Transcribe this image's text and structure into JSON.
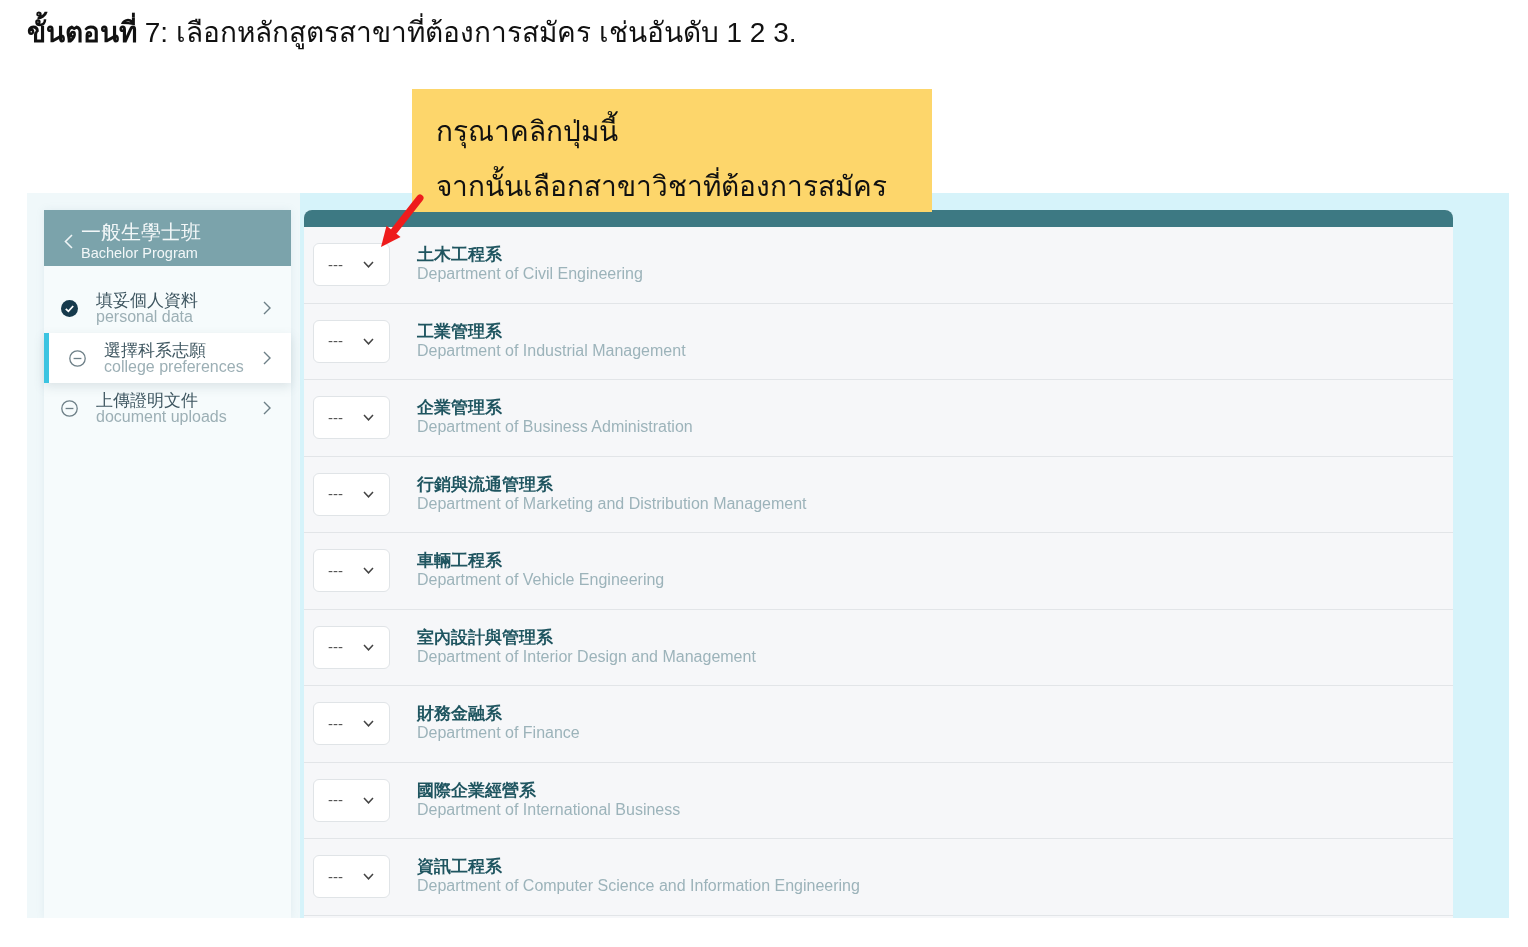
{
  "instruction": {
    "text": "**ขั้นตอนที่** 7: เลือกหลักสูตรสาขาที่ต้องการสมัคร เช่นอันดับ 1 2 3."
  },
  "callout": {
    "lines": [
      "กรุณาคลิกปุ่มนี้",
      "จากนั้นเลือกสาขาวิชาที่ต้องการสมัคร"
    ]
  },
  "sidebar": {
    "title": "一般生學士班",
    "subtitle": "Bachelor Program",
    "items": [
      {
        "label": "填妥個人資料",
        "sublabel": "personal data",
        "completed": true,
        "selected": false
      },
      {
        "label": "選擇科系志願",
        "sublabel": "college preferences",
        "completed": false,
        "selected": true
      },
      {
        "label": "上傳證明文件",
        "sublabel": "document uploads",
        "completed": false,
        "selected": false
      }
    ]
  },
  "departments": [
    {
      "name": "土木工程系",
      "name_en": "Department of Civil Engineering",
      "rank": "---"
    },
    {
      "name": "工業管理系",
      "name_en": "Department of Industrial Management",
      "rank": "---"
    },
    {
      "name": "企業管理系",
      "name_en": "Department of Business Administration",
      "rank": "---"
    },
    {
      "name": "行銷與流通管理系",
      "name_en": "Department of Marketing and Distribution Management",
      "rank": "---"
    },
    {
      "name": "車輛工程系",
      "name_en": "Department of Vehicle Engineering",
      "rank": "---"
    },
    {
      "name": "室內設計與管理系",
      "name_en": "Department of Interior Design and Management",
      "rank": "---"
    },
    {
      "name": "財務金融系",
      "name_en": "Department of Finance",
      "rank": "---"
    },
    {
      "name": "國際企業經營系",
      "name_en": "Department of International Business",
      "rank": "---"
    },
    {
      "name": "資訊工程系",
      "name_en": "Department of Computer Science and Information Engineering",
      "rank": "---"
    }
  ]
}
